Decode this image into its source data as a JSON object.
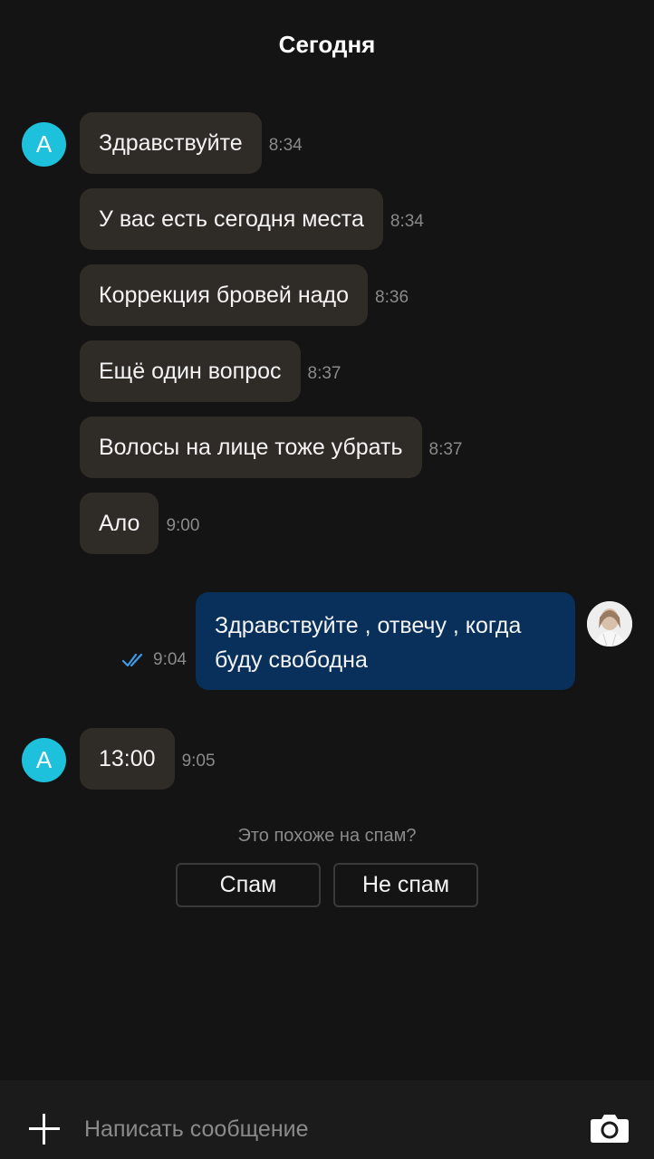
{
  "header": {
    "date": "Сегодня"
  },
  "sender": {
    "initial": "A",
    "avatar_color": "#1ec1dc"
  },
  "incoming_messages": [
    {
      "text": "Здравствуйте",
      "time": "8:34"
    },
    {
      "text": "У вас есть сегодня места",
      "time": "8:34"
    },
    {
      "text": "Коррекция бровей надо",
      "time": "8:36"
    },
    {
      "text": "Ещё один вопрос",
      "time": "8:37"
    },
    {
      "text": "Волосы на лице тоже убрать",
      "time": "8:37"
    },
    {
      "text": "Ало",
      "time": "9:00"
    }
  ],
  "outgoing_message": {
    "text": "Здравствуйте , отвечу , когда буду свободна",
    "time": "9:04",
    "status_icon": "double-check-icon"
  },
  "late_message": {
    "text": "13:00",
    "time": "9:05"
  },
  "spam_prompt": {
    "question": "Это похоже на спам?",
    "spam_label": "Спам",
    "not_spam_label": "Не спам"
  },
  "composer": {
    "placeholder": "Написать сообщение",
    "attach_icon": "plus-icon",
    "camera_icon": "camera-icon"
  },
  "colors": {
    "background": "#141414",
    "incoming_bubble": "#2f2b27",
    "outgoing_bubble": "#08305a",
    "read_check": "#3d9be9"
  }
}
